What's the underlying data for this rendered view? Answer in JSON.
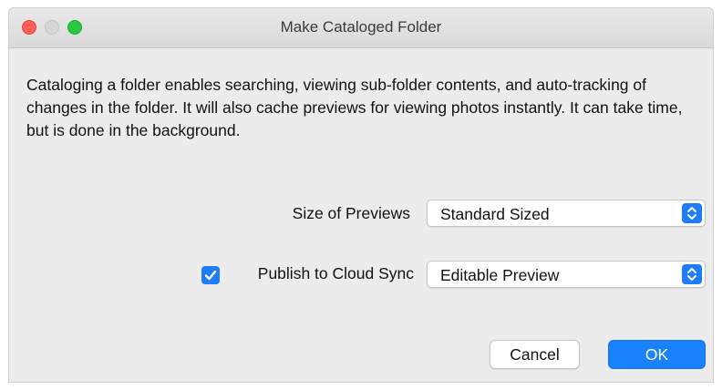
{
  "window": {
    "title": "Make Cataloged Folder"
  },
  "description": "Cataloging a folder enables searching, viewing sub-folder contents, and auto-tracking of changes in the folder. It will also cache previews for viewing photos instantly. It can take time, but is done in the background.",
  "size_of_previews": {
    "label": "Size of Previews",
    "selected": "Standard Sized",
    "icon": "up-down-chevron-icon"
  },
  "cloud_sync": {
    "label": "Publish to Cloud Sync",
    "checked": true,
    "selected": "Editable Preview",
    "icon": "up-down-chevron-icon"
  },
  "buttons": {
    "cancel": "Cancel",
    "ok": "OK"
  },
  "colors": {
    "accent": "#1e7cf5",
    "traffic_close": "#ff5f57",
    "traffic_minimize": "#d6d6d6",
    "traffic_zoom": "#28c840"
  }
}
